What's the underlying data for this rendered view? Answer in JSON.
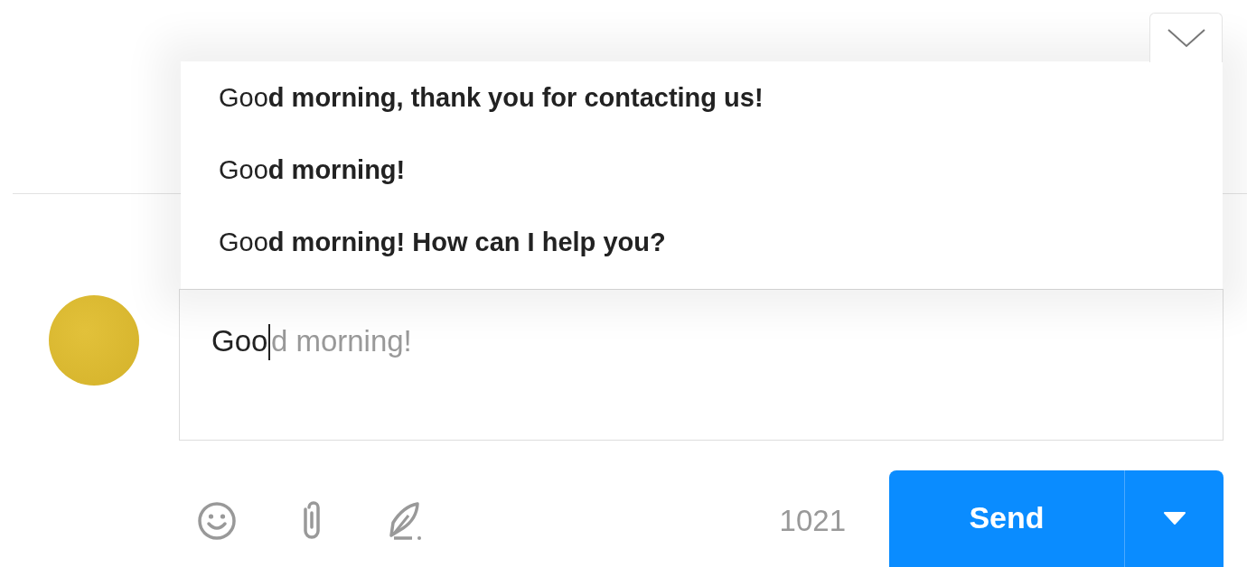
{
  "suggestions": [
    {
      "text": "Goo**d morning, thank you for contacting us!**"
    },
    {
      "text": "Goo**d morning!**"
    },
    {
      "text": "Goo**d morning! How can I help you?**"
    }
  ],
  "composer": {
    "value": "Goo",
    "completion": "d morning!"
  },
  "toolbar": {
    "character_count": "1021"
  },
  "send": {
    "label": "Send"
  }
}
